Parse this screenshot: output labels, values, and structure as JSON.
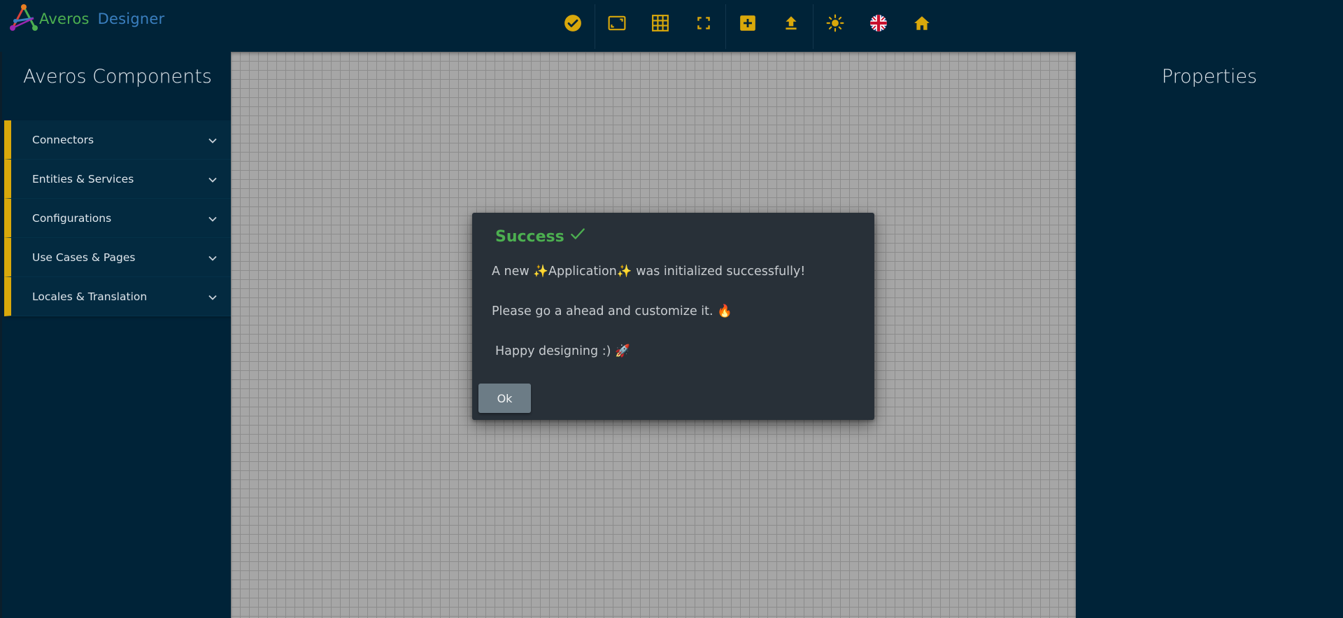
{
  "app": {
    "logo_word1": "Averos",
    "logo_word2": "Designer"
  },
  "toolbar": {
    "buttons": [
      {
        "icon": "check-circle-icon"
      },
      {
        "icon": "aspect-ratio-icon"
      },
      {
        "icon": "grid-icon"
      },
      {
        "icon": "fullscreen-icon"
      },
      {
        "icon": "add-box-icon"
      },
      {
        "icon": "upload-icon"
      },
      {
        "icon": "brightness-icon"
      },
      {
        "icon": "uk-flag-icon"
      },
      {
        "icon": "home-icon"
      }
    ],
    "icon_color": "#d9a80b"
  },
  "left_panel": {
    "title": "Averos Components",
    "items": [
      {
        "label": "Connectors"
      },
      {
        "label": "Entities & Services"
      },
      {
        "label": "Configurations"
      },
      {
        "label": "Use Cases & Pages"
      },
      {
        "label": "Locales & Translation"
      }
    ]
  },
  "right_panel": {
    "title": "Properties"
  },
  "dialog": {
    "title": "Success",
    "line1": "A new ✨Application✨ was initialized successfully!",
    "line2": "Please go a ahead and customize it. 🔥",
    "line3": "Happy designing :) 🚀",
    "ok_label": "Ok",
    "title_color": "#4caf50"
  },
  "colors": {
    "background": "#002338",
    "accent": "#d9a80b",
    "canvas": "#a6a6a6"
  }
}
